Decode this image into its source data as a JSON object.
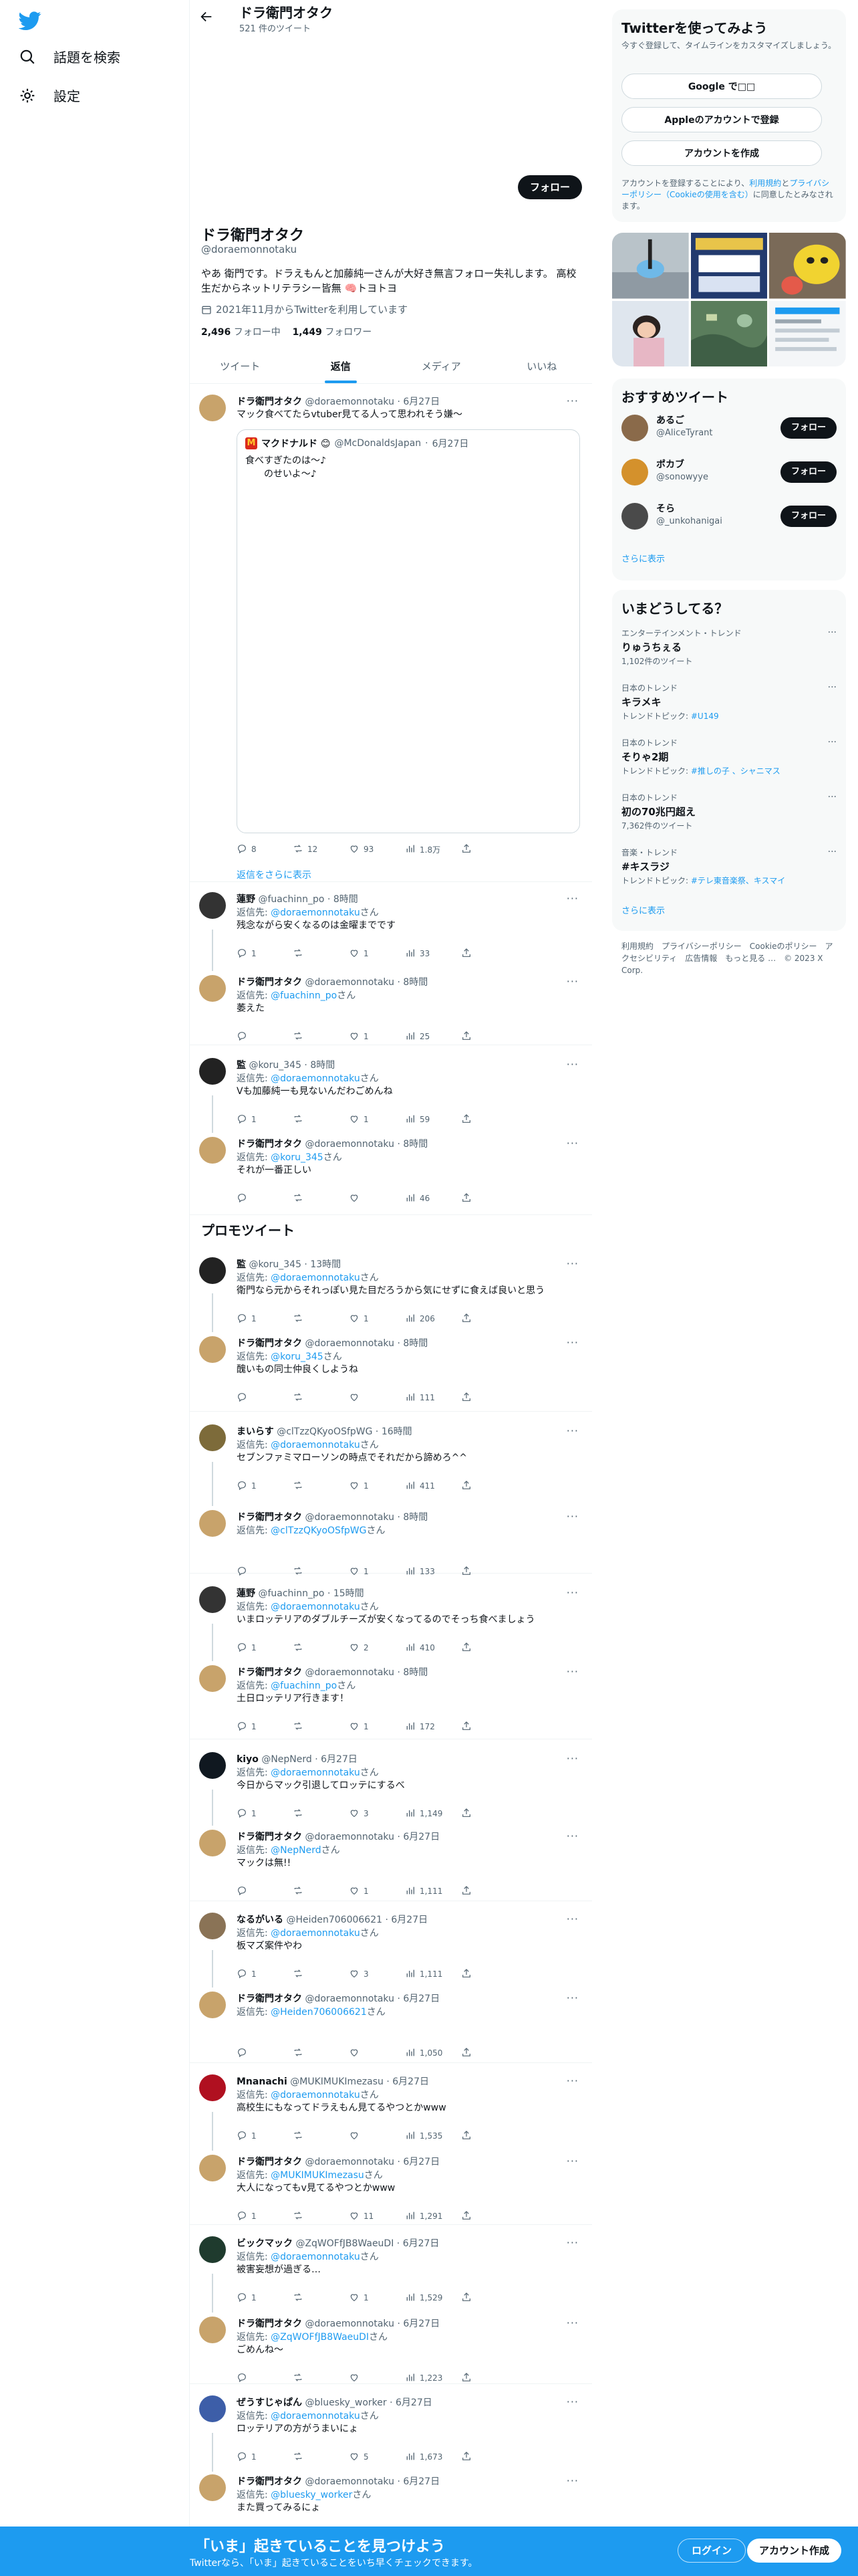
{
  "nav": {
    "search_label": "話題を検索",
    "settings_label": "設定"
  },
  "header": {
    "name": "ドラ衛門オタク",
    "tweet_count": "521 件のツイート"
  },
  "profile": {
    "follow_label": "フォロー",
    "name": "ドラ衛門オタク",
    "handle": "@doraemonnotaku",
    "bio": "やあ 衛門です。ドラえもんと加藤純一さんが大好き無言フォロー失礼します。 高校生だからネットリテラシー皆無 🧠トヨトヨ",
    "joined": "2021年11月からTwitterを利用しています",
    "following_count": "2,496",
    "following_label": "フォロー中",
    "followers_count": "1,449",
    "followers_label": "フォロワー"
  },
  "tabs": [
    "ツイート",
    "返信",
    "メディア",
    "いいね"
  ],
  "active_tab": "返信",
  "colors": {
    "accent": "#1d9bf0",
    "text": "#0f1419",
    "muted": "#536471"
  },
  "quote": {
    "name": "マクドナルド 😊",
    "handle": "@McDonaldsJapan",
    "date": "6月27日",
    "text": "食べすぎたのは～♪\n　　のせいよ～♪"
  },
  "show_replies_label": "返信をさらに表示",
  "promo_title": "プロモツイート",
  "reply_to_label": "返信先:",
  "reply_to_suffix": "さん",
  "tweets": [
    {
      "name": "ドラ衛門オタク",
      "handle": "@doraemonnotaku",
      "time": "6月27日",
      "reply_to": "",
      "text": "マック食べてたらvtuber見てる人って思われそう嫌～",
      "replies": "8",
      "retweets": "12",
      "likes": "93",
      "views": "1.8万"
    },
    {
      "name": "蓮野",
      "handle": "@fuachinn_po",
      "time": "8時間",
      "reply_to": "@doraemonnotaku",
      "text": "残念ながら安くなるのは金曜までです",
      "replies": "1",
      "retweets": "",
      "likes": "1",
      "views": "33"
    },
    {
      "name": "ドラ衛門オタク",
      "handle": "@doraemonnotaku",
      "time": "8時間",
      "reply_to": "@fuachinn_po",
      "text": "萎えた",
      "replies": "",
      "retweets": "",
      "likes": "1",
      "views": "25"
    },
    {
      "name": "監",
      "handle": "@koru_345",
      "time": "8時間",
      "reply_to": "@doraemonnotaku",
      "text": "Vも加藤純一も見ないんだわごめんね",
      "replies": "1",
      "retweets": "",
      "likes": "1",
      "views": "59"
    },
    {
      "name": "ドラ衛門オタク",
      "handle": "@doraemonnotaku",
      "time": "8時間",
      "reply_to": "@koru_345",
      "text": "それが一番正しい",
      "replies": "",
      "retweets": "",
      "likes": "",
      "views": "46"
    },
    {
      "name": "監",
      "handle": "@koru_345",
      "time": "13時間",
      "reply_to": "@doraemonnotaku",
      "text": "衛門なら元からそれっぽい見た目だろうから気にせずに食えば良いと思う",
      "replies": "1",
      "retweets": "",
      "likes": "1",
      "views": "206"
    },
    {
      "name": "ドラ衛門オタク",
      "handle": "@doraemonnotaku",
      "time": "8時間",
      "reply_to": "@koru_345",
      "text": "醜いもの同士仲良くしようね",
      "replies": "",
      "retweets": "",
      "likes": "",
      "views": "111"
    },
    {
      "name": "まいらす",
      "handle": "@clTzzQKyoOSfpWG",
      "time": "16時間",
      "reply_to": "@doraemonnotaku",
      "text": "セブンファミマローソンの時点でそれだから諦めろ^^",
      "replies": "1",
      "retweets": "",
      "likes": "1",
      "views": "411"
    },
    {
      "name": "ドラ衛門オタク",
      "handle": "@doraemonnotaku",
      "time": "8時間",
      "reply_to": "@clTzzQKyoOSfpWG",
      "text": "",
      "replies": "",
      "retweets": "",
      "likes": "1",
      "views": "133"
    },
    {
      "name": "蓮野",
      "handle": "@fuachinn_po",
      "time": "15時間",
      "reply_to": "@doraemonnotaku",
      "text": "いまロッテリアのダブルチーズが安くなってるのでそっち食べましょう",
      "replies": "1",
      "retweets": "",
      "likes": "2",
      "views": "410"
    },
    {
      "name": "ドラ衛門オタク",
      "handle": "@doraemonnotaku",
      "time": "8時間",
      "reply_to": "@fuachinn_po",
      "text": "土日ロッテリア行きます！",
      "replies": "1",
      "retweets": "",
      "likes": "1",
      "views": "172"
    },
    {
      "name": "kiyo",
      "handle": "@NepNerd",
      "time": "6月27日",
      "reply_to": "@doraemonnotaku",
      "text": "今日からマック引退してロッテにするべ",
      "replies": "1",
      "retweets": "",
      "likes": "3",
      "views": "1,149"
    },
    {
      "name": "ドラ衛門オタク",
      "handle": "@doraemonnotaku",
      "time": "6月27日",
      "reply_to": "@NepNerd",
      "text": "マックは無!!",
      "replies": "",
      "retweets": "",
      "likes": "1",
      "views": "1,111"
    },
    {
      "name": "なるがいる",
      "handle": "@Heiden706006621",
      "time": "6月27日",
      "reply_to": "@doraemonnotaku",
      "text": "板マズ案件やわ",
      "replies": "1",
      "retweets": "",
      "likes": "3",
      "views": "1,111"
    },
    {
      "name": "ドラ衛門オタク",
      "handle": "@doraemonnotaku",
      "time": "6月27日",
      "reply_to": "@Heiden706006621",
      "text": "",
      "replies": "",
      "retweets": "",
      "likes": "",
      "views": "1,050"
    },
    {
      "name": "Mnanachi",
      "handle": "@MUKIMUKImezasu",
      "time": "6月27日",
      "reply_to": "@doraemonnotaku",
      "text": "高校生にもなってドラえもん見てるやつとかwww",
      "replies": "1",
      "retweets": "",
      "likes": "",
      "views": "1,535"
    },
    {
      "name": "ドラ衛門オタク",
      "handle": "@doraemonnotaku",
      "time": "6月27日",
      "reply_to": "@MUKIMUKImezasu",
      "text": "大人になってもv見てるやつとかwww",
      "replies": "1",
      "retweets": "",
      "likes": "11",
      "views": "1,291"
    },
    {
      "name": "ビックマック",
      "handle": "@ZqWOFfJB8WaeuDI",
      "time": "6月27日",
      "reply_to": "@doraemonnotaku",
      "text": "被害妄想が過ぎる…",
      "replies": "1",
      "retweets": "",
      "likes": "1",
      "views": "1,529"
    },
    {
      "name": "ドラ衛門オタク",
      "handle": "@doraemonnotaku",
      "time": "6月27日",
      "reply_to": "@ZqWOFfJB8WaeuDI",
      "text": "ごめんね～",
      "replies": "",
      "retweets": "",
      "likes": "",
      "views": "1,223"
    },
    {
      "name": "ぜうすじゃぱん",
      "handle": "@bluesky_worker",
      "time": "6月27日",
      "reply_to": "@doraemonnotaku",
      "text": "ロッテリアの方がうまいにょ",
      "replies": "1",
      "retweets": "",
      "likes": "5",
      "views": "1,673"
    },
    {
      "name": "ドラ衛門オタク",
      "handle": "@doraemonnotaku",
      "time": "6月27日",
      "reply_to": "@bluesky_worker",
      "text": "また買ってみるにょ",
      "replies": "",
      "retweets": "",
      "likes": "",
      "views": ""
    }
  ],
  "right": {
    "signup_title": "Twitterを使ってみよう",
    "signup_sub": "今すぐ登録して、タイムラインをカスタマイズしましょう。",
    "google_label": "Google で□□",
    "apple_label": "Appleのアカウントで登録",
    "create_label": "アカウントを作成",
    "terms_prefix": "アカウントを登録することにより、",
    "terms_link1": "利用規約",
    "terms_and": "と",
    "terms_link2": "プライバシーポリシー（Cookieの使用を含む）",
    "terms_suffix": "に同意したとみなされます。",
    "rec_title": "おすすめツイート",
    "rec_users": [
      {
        "name": "あるご",
        "handle": "@AliceTyrant",
        "button": "フォロー"
      },
      {
        "name": "ポカブ",
        "handle": "@sonowyye",
        "button": "フォロー"
      },
      {
        "name": "そら",
        "handle": "@_unkohanigai",
        "button": "フォロー"
      }
    ],
    "rec_more": "さらに表示",
    "trends_title": "いまどうしてる？",
    "trends": [
      {
        "category": "エンターテインメント・トレンド",
        "name": "りゅうちぇる",
        "extra": "1,102件のツイート",
        "extra_link": ""
      },
      {
        "category": "日本のトレンド",
        "name": "キラメキ",
        "extra": "トレンドトピック: ",
        "extra_link": "#U149"
      },
      {
        "category": "日本のトレンド",
        "name": "そりゃ2期",
        "extra": "トレンドトピック: ",
        "extra_link": "#推しの子 、シャニマス"
      },
      {
        "category": "日本のトレンド",
        "name": "初の70兆円超え",
        "extra": "7,362件のツイート",
        "extra_link": ""
      },
      {
        "category": "音楽・トレンド",
        "name": "#キスラジ",
        "extra": "トレンドトピック: ",
        "extra_link": "#テレ東音楽祭、キスマイ"
      }
    ],
    "trends_more": "さらに表示",
    "footer": "利用規約　プライバシーポリシー　Cookieのポリシー　アクセシビリティ　広告情報　もっと見る …　© 2023 X Corp."
  },
  "bottom": {
    "title": "「いま」起きていることを見つけよう",
    "sub": "Twitterなら、「いま」起きていることをいち早くチェックできます。",
    "login": "ログイン",
    "signup": "アカウント作成"
  }
}
